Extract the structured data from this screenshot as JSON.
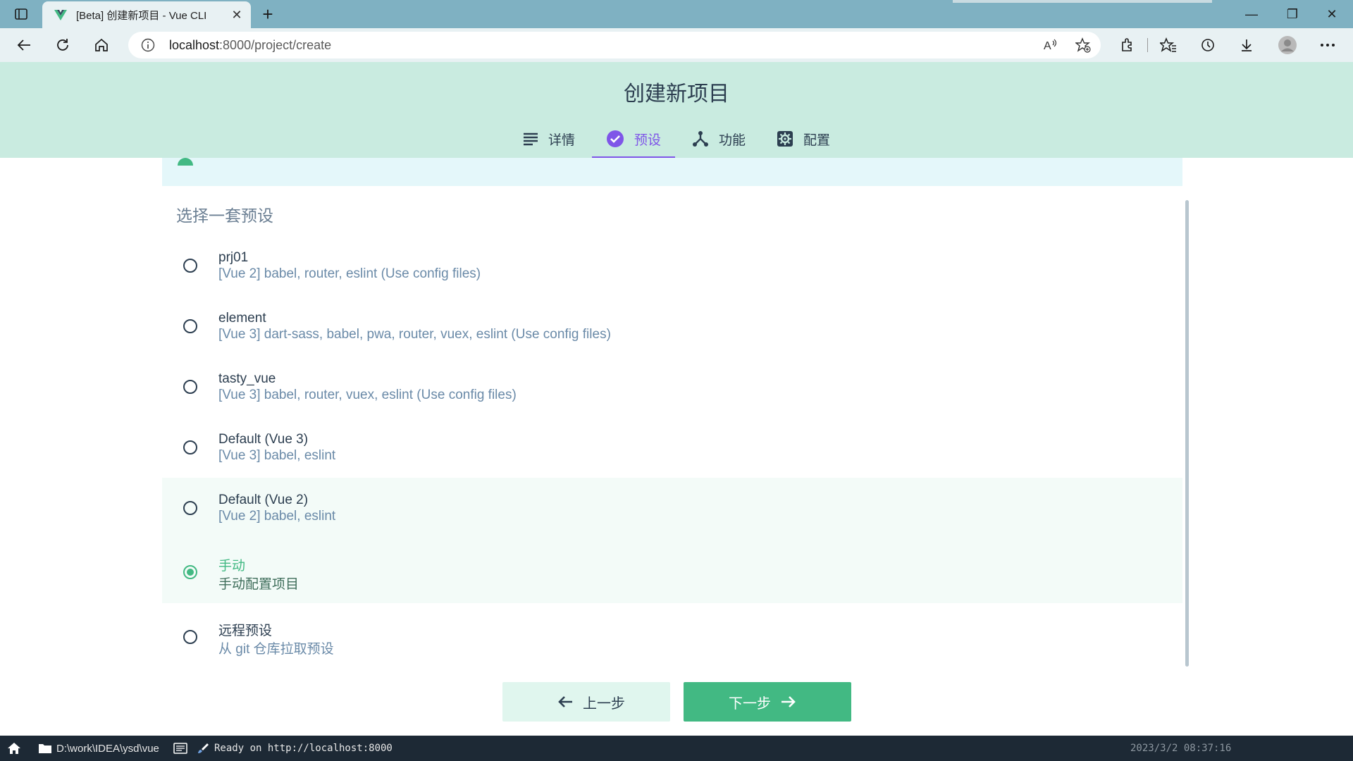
{
  "browser": {
    "tab_title": "[Beta] 创建新项目 - Vue CLI",
    "tab_close": "✕",
    "new_tab": "+",
    "url_host": "localhost",
    "url_rest": ":8000/project/create",
    "window_controls": [
      "—",
      "❐",
      "✕"
    ]
  },
  "header": {
    "title": "创建新项目",
    "steps": [
      {
        "label": "详情",
        "icon": "list-icon",
        "active": false
      },
      {
        "label": "预设",
        "icon": "check-circle-icon",
        "active": true
      },
      {
        "label": "功能",
        "icon": "fork-icon",
        "active": false
      },
      {
        "label": "配置",
        "icon": "settings-icon",
        "active": false
      }
    ]
  },
  "main": {
    "section_title": "选择一套预设",
    "presets": [
      {
        "name": "prj01",
        "desc": "[Vue 2] babel, router, eslint (Use config files)",
        "selected": false
      },
      {
        "name": "element",
        "desc": "[Vue 3] dart-sass, babel, pwa, router, vuex, eslint (Use config files)",
        "selected": false
      },
      {
        "name": "tasty_vue",
        "desc": "[Vue 3] babel, router, vuex, eslint (Use config files)",
        "selected": false
      },
      {
        "name": "Default (Vue 3)",
        "desc": "[Vue 3] babel, eslint",
        "selected": false
      },
      {
        "name": "Default (Vue 2)",
        "desc": "[Vue 2] babel, eslint",
        "selected": false
      },
      {
        "name": "手动",
        "desc": "手动配置项目",
        "selected": true
      },
      {
        "name": "远程预设",
        "desc": "从 git 仓库拉取预设",
        "selected": false
      }
    ]
  },
  "footer": {
    "prev_label": "上一步",
    "next_label": "下一步"
  },
  "statusbar": {
    "folder": "D:\\work\\IDEA\\ysd\\vue",
    "status": "Ready on http://localhost:8000",
    "time": "2023/3/2 08:37:16"
  },
  "colors": {
    "accent": "#42b983",
    "active_step": "#7f55e8",
    "header_bg": "#c9ebe0",
    "statusbar_bg": "#1d2935"
  }
}
